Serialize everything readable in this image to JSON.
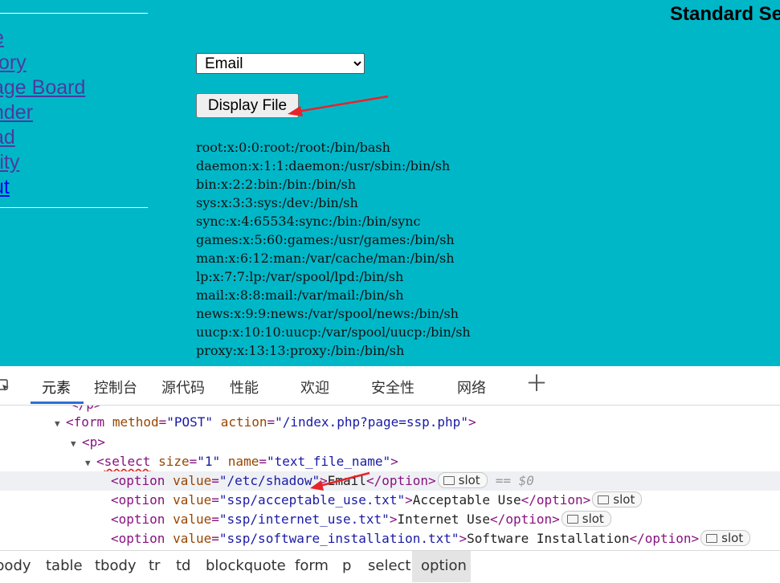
{
  "page": {
    "title": "Standard Se",
    "nav_links": [
      "e",
      "tory",
      "age Board",
      "nder",
      "ad",
      "rity",
      "ut"
    ],
    "select": {
      "selected": "Email"
    },
    "button": {
      "label": "Display File"
    },
    "file_lines": [
      "root:x:0:0:root:/root:/bin/bash",
      "daemon:x:1:1:daemon:/usr/sbin:/bin/sh",
      "bin:x:2:2:bin:/bin:/bin/sh",
      "sys:x:3:3:sys:/dev:/bin/sh",
      "sync:x:4:65534:sync:/bin:/bin/sync",
      "games:x:5:60:games:/usr/games:/bin/sh",
      "man:x:6:12:man:/var/cache/man:/bin/sh",
      "lp:x:7:7:lp:/var/spool/lpd:/bin/sh",
      "mail:x:8:8:mail:/var/mail:/bin/sh",
      "news:x:9:9:news:/var/spool/news:/bin/sh",
      "uucp:x:10:10:uucp:/var/spool/uucp:/bin/sh",
      "proxy:x:13:13:proxy:/bin:/bin/sh"
    ],
    "background_color": "#00b7c8"
  },
  "devtools": {
    "tabs": [
      "元素",
      "控制台",
      "源代码",
      "性能",
      "欢迎",
      "安全性",
      "网络"
    ],
    "active_tab": "元素",
    "tree": {
      "line0": {
        "text": "</p>"
      },
      "form": {
        "tag": "form",
        "method_attr": "method",
        "method_val": "\"POST\"",
        "action_attr": "action",
        "action_val": "\"/index.php?page=ssp.php\""
      },
      "p": {
        "tag": "p"
      },
      "select": {
        "tag": "select",
        "size_attr": "size",
        "size_val": "\"1\"",
        "name_attr": "name",
        "name_val": "\"text_file_name\""
      },
      "options": [
        {
          "value": "\"/etc/shadow\"",
          "label": "Email",
          "dollar": "== $0"
        },
        {
          "value": "\"ssp/acceptable_use.txt\"",
          "label": "Acceptable Use"
        },
        {
          "value": "\"ssp/internet_use.txt\"",
          "label": "Internet Use"
        },
        {
          "value": "\"ssp/software_installation.txt\"",
          "label": "Software Installation"
        }
      ],
      "slot_label": "slot",
      "option_tag": "option",
      "value_attr": "value"
    },
    "breadcrumb": [
      "body",
      "table",
      "tbody",
      "tr",
      "td",
      "blockquote",
      "form",
      "p",
      "select",
      "option"
    ],
    "active_crumb": "option"
  }
}
